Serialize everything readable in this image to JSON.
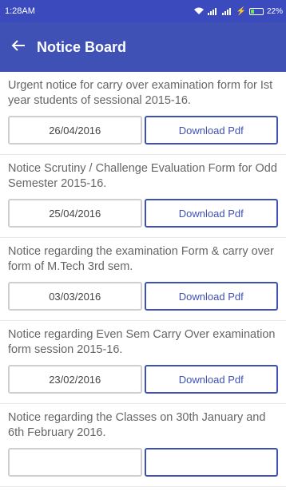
{
  "status_bar": {
    "time": "1:28AM",
    "battery": "22%"
  },
  "header": {
    "title": "Notice Board"
  },
  "notices": [
    {
      "text": "Urgent notice for carry over examination form for Ist year students of sessional 2015-16.",
      "date": "26/04/2016",
      "button": "Download Pdf"
    },
    {
      "text": "Notice Scrutiny / Challenge Evaluation Form for Odd Semester 2015-16.",
      "date": "25/04/2016",
      "button": "Download Pdf"
    },
    {
      "text": "Notice regarding the examination Form & carry over form of M.Tech 3rd sem.",
      "date": "03/03/2016",
      "button": "Download Pdf"
    },
    {
      "text": "Notice regarding Even Sem Carry Over examination form session 2015-16.",
      "date": "23/02/2016",
      "button": "Download Pdf"
    },
    {
      "text": "Notice regarding the Classes on 30th January and 6th February 2016.",
      "date": "",
      "button": ""
    }
  ]
}
